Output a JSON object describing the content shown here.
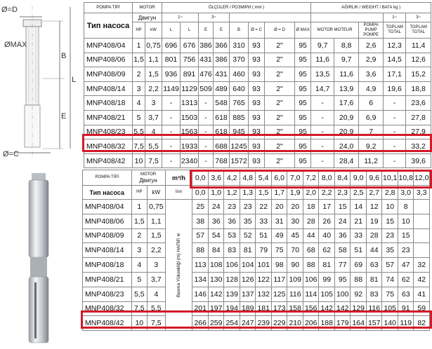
{
  "drawing": {
    "labels": {
      "d": "Ø=D",
      "max": "ØMAX",
      "b": "B",
      "l": "L",
      "e": "E",
      "c": "Ø=C"
    }
  },
  "table1": {
    "head": {
      "pompa_tipi": "POMPA TİPİ",
      "tip_nasosa": "Тип насоса",
      "motor": "MOTOR",
      "dvigun": "Двигун",
      "olculer": "ÖLÇÜLER / РОЗМІРИ ( mm )",
      "agirlik": "AĞIRLIK / WEIGHT / ВАГА kg )",
      "one_tilde_a": "1~",
      "three_tilde_a": "3~",
      "one_tilde_b": "1~",
      "three_tilde_b": "3~",
      "hp": "HP",
      "kw": "kW",
      "cols": [
        "L",
        "L",
        "E",
        "E",
        "B",
        "Ø = C",
        "Ø = D",
        "Ø MAX"
      ],
      "motor_moteur": "MOTOR MOTEUR",
      "pompa_pump": "POMPA PUMP POMPE",
      "toplam_a": "TOPLAM TOTAL",
      "toplam_b": "TOPLAM TOTAL"
    },
    "rows": [
      [
        "MNP408/04",
        "1",
        "0,75",
        "696",
        "676",
        "386",
        "366",
        "310",
        "93",
        "2\"",
        "95",
        "9,7",
        "8,8",
        "2,6",
        "12,3",
        "11,4"
      ],
      [
        "MNP408/06",
        "1,5",
        "1,1",
        "801",
        "756",
        "431",
        "386",
        "370",
        "93",
        "2\"",
        "95",
        "11,6",
        "9,7",
        "2,9",
        "14,5",
        "12,6"
      ],
      [
        "MNP408/09",
        "2",
        "1,5",
        "936",
        "891",
        "476",
        "431",
        "460",
        "93",
        "2\"",
        "95",
        "13,5",
        "11,6",
        "3,6",
        "17,1",
        "15,2"
      ],
      [
        "MNP408/14",
        "3",
        "2,2",
        "1149",
        "1129",
        "509",
        "489",
        "640",
        "93",
        "2\"",
        "95",
        "14,7",
        "13,9",
        "4,9",
        "19,6",
        "18,8"
      ],
      [
        "MNP408/18",
        "4",
        "3",
        "-",
        "1313",
        "-",
        "548",
        "765",
        "93",
        "2\"",
        "95",
        "-",
        "17,6",
        "6",
        "-",
        "23,6"
      ],
      [
        "MNP408/21",
        "5",
        "3,7",
        "-",
        "1503",
        "-",
        "618",
        "885",
        "93",
        "2\"",
        "95",
        "-",
        "20,9",
        "6,9",
        "-",
        "27,8"
      ],
      [
        "MNP408/23",
        "5,5",
        "4",
        "-",
        "1563",
        "-",
        "618",
        "945",
        "93",
        "2\"",
        "95",
        "-",
        "20,9",
        "7",
        "-",
        "27,9"
      ],
      [
        "MNP408/32",
        "7,5",
        "5,5",
        "-",
        "1933",
        "-",
        "688",
        "1245",
        "93",
        "2\"",
        "95",
        "-",
        "24,0",
        "9,2",
        "-",
        "33,2"
      ],
      [
        "MNP408/42",
        "10",
        "7,5",
        "-",
        "2340",
        "-",
        "768",
        "1572",
        "93",
        "2\"",
        "95",
        "-",
        "28,4",
        "11,2",
        "-",
        "39,6"
      ]
    ]
  },
  "table2": {
    "head": {
      "pompa_tipi": "POMPA TİPİ",
      "motor": "MOTOR",
      "dvigun": "Двигун",
      "flow_unit_m3h": "m³/h",
      "flow_unit_ls": "l/sn",
      "tip_nasosa": "Тип насоса",
      "hp": "HP",
      "kw": "kW",
      "head_label": "Basma Yüksekliği (m) НАПІР, м"
    },
    "flow_m3h": [
      "0,0",
      "3,6",
      "4,2",
      "4,8",
      "5,4",
      "6,0",
      "7,0",
      "7,2",
      "8,0",
      "8,4",
      "9,0",
      "9,6",
      "10,1",
      "10,8",
      "12,0"
    ],
    "flow_ls": [
      "0,0",
      "1,0",
      "1,2",
      "1,3",
      "1,5",
      "1,7",
      "1,9",
      "2,0",
      "2,2",
      "2,3",
      "2,5",
      "2,7",
      "2,8",
      "3,0",
      "3,3"
    ],
    "rows": [
      {
        "model": "MNP408/04",
        "hp": "1",
        "kw": "0,75",
        "vals": [
          "25",
          "24",
          "23",
          "23",
          "22",
          "20",
          "20",
          "18",
          "17",
          "15",
          "14",
          "12",
          "10",
          "8"
        ]
      },
      {
        "model": "MNP408/06",
        "hp": "1,5",
        "kw": "1,1",
        "vals": [
          "38",
          "36",
          "36",
          "35",
          "33",
          "31",
          "30",
          "28",
          "26",
          "24",
          "21",
          "19",
          "15",
          "10"
        ]
      },
      {
        "model": "MNP408/09",
        "hp": "2",
        "kw": "1,5",
        "vals": [
          "57",
          "54",
          "53",
          "52",
          "51",
          "49",
          "45",
          "44",
          "40",
          "36",
          "33",
          "28",
          "23",
          "15"
        ]
      },
      {
        "model": "MNP408/14",
        "hp": "3",
        "kw": "2,2",
        "vals": [
          "88",
          "84",
          "83",
          "81",
          "79",
          "75",
          "70",
          "68",
          "62",
          "58",
          "51",
          "44",
          "35",
          "23"
        ]
      },
      {
        "model": "MNP408/18",
        "hp": "4",
        "kw": "3",
        "vals": [
          "113",
          "108",
          "106",
          "104",
          "101",
          "98",
          "90",
          "88",
          "81",
          "77",
          "69",
          "63",
          "57",
          "47",
          "32"
        ]
      },
      {
        "model": "MNP408/21",
        "hp": "5",
        "kw": "3,7",
        "vals": [
          "134",
          "130",
          "128",
          "126",
          "122",
          "117",
          "109",
          "106",
          "99",
          "95",
          "88",
          "81",
          "74",
          "62",
          "42"
        ]
      },
      {
        "model": "MNP408/23",
        "hp": "5,5",
        "kw": "4",
        "vals": [
          "146",
          "142",
          "139",
          "137",
          "132",
          "125",
          "116",
          "114",
          "105",
          "100",
          "92",
          "83",
          "75",
          "63",
          "41"
        ]
      },
      {
        "model": "MNP408/32",
        "hp": "7,5",
        "kw": "5,5",
        "vals": [
          "201",
          "197",
          "194",
          "189",
          "181",
          "173",
          "158",
          "156",
          "142",
          "142",
          "129",
          "116",
          "105",
          "91",
          "59"
        ]
      },
      {
        "model": "MNP408/42",
        "hp": "10",
        "kw": "7,5",
        "vals": [
          "266",
          "259",
          "254",
          "247",
          "239",
          "229",
          "210",
          "206",
          "188",
          "179",
          "164",
          "157",
          "140",
          "119",
          "82"
        ]
      }
    ]
  },
  "colors": {
    "highlight": "#d21a2a"
  }
}
